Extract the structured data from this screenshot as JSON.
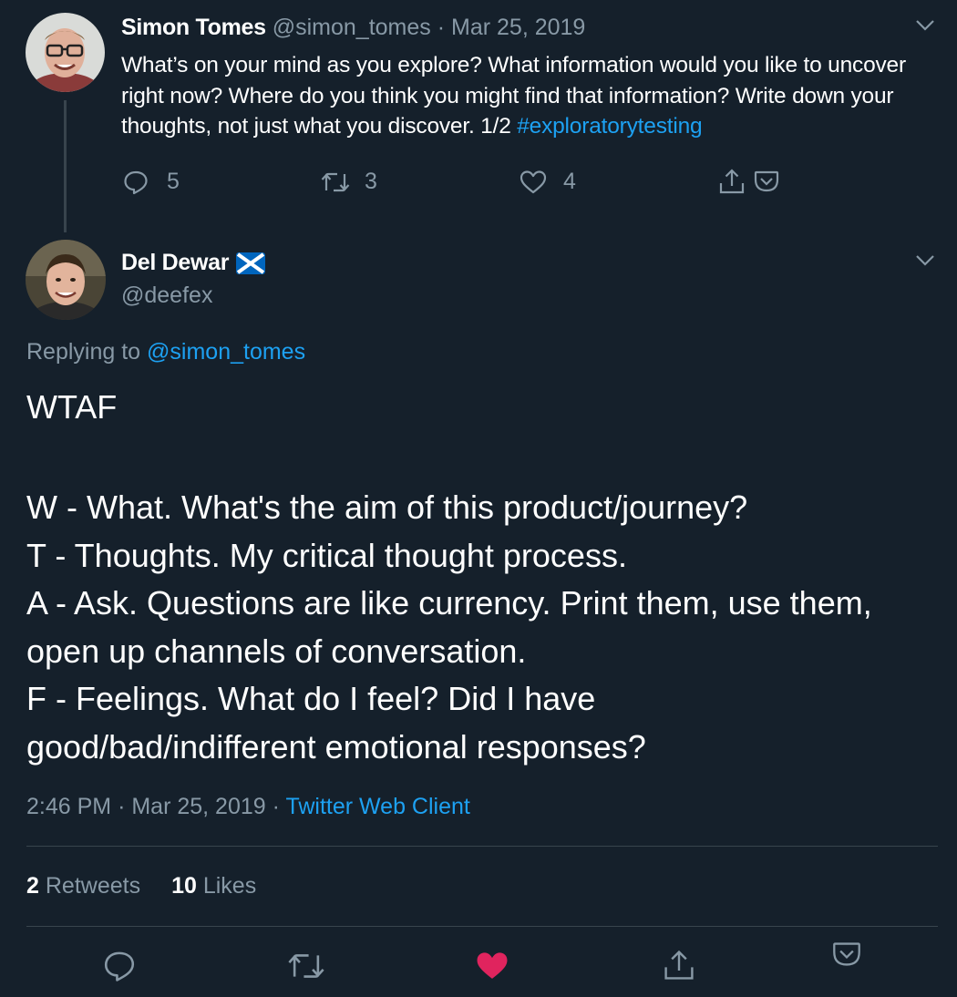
{
  "parent_tweet": {
    "name": "Simon Tomes",
    "handle": "@simon_tomes",
    "separator": "·",
    "date": "Mar 25, 2019",
    "text": "What’s on your mind as you explore? What information would you like to uncover right now? Where do you think you might find that information? Write down your thoughts, not just what you discover. 1/2 ",
    "hashtag": "#exploratorytesting",
    "replies": "5",
    "retweets": "3",
    "likes": "4"
  },
  "reply_tweet": {
    "name": "Del Dewar",
    "handle": "@deefex",
    "replying_prefix": "Replying to ",
    "replying_to": "@simon_tomes",
    "title": "WTAF",
    "lines": [
      "W - What. What's the aim of this product/journey?",
      "T - Thoughts. My critical thought process.",
      "A - Ask. Questions are like currency. Print them, use them, open up channels of conversation.",
      "F - Feelings. What do I feel? Did I have good/bad/indifferent emotional responses?"
    ],
    "time": "2:46 PM",
    "meta_sep1": "·",
    "date": "Mar 25, 2019",
    "meta_sep2": "·",
    "client": "Twitter Web Client",
    "retweet_count": "2",
    "retweet_label": "Retweets",
    "like_count": "10",
    "like_label": "Likes"
  },
  "icons": {
    "reply": "reply-icon",
    "retweet": "retweet-icon",
    "like": "heart-icon",
    "share": "share-icon",
    "pocket": "pocket-icon",
    "more": "chevron-down-icon",
    "flag": "scotland-flag-icon"
  },
  "colors": {
    "background": "#15202b",
    "accent": "#1da1f2",
    "muted": "#8899a6",
    "like_active": "#e0245e"
  }
}
